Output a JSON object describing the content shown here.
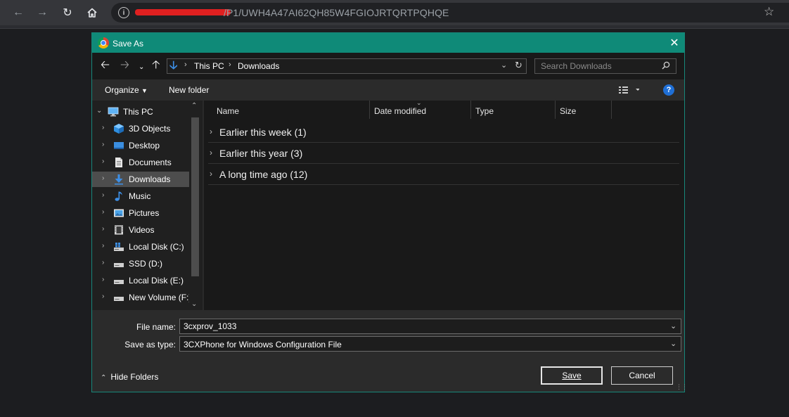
{
  "browser": {
    "url_visible": "/P1/UWH4A47AI62QH85W4FGIOJRTQRTPQHQE",
    "icons": [
      "back-icon",
      "forward-icon",
      "reload-icon",
      "home-icon",
      "info-icon",
      "star-icon"
    ]
  },
  "dialog": {
    "title": "Save As",
    "close_glyph": "✕",
    "accent_color": "#0f8a78",
    "path": {
      "crumbs": [
        "This PC",
        "Downloads"
      ]
    },
    "search": {
      "placeholder": "Search Downloads",
      "value": ""
    },
    "toolbar": {
      "organize_label": "Organize",
      "new_folder_label": "New folder",
      "help_glyph": "?"
    },
    "nav": {
      "items": [
        {
          "label": "This PC",
          "icon": "pc-icon",
          "level": 0,
          "expanded": true
        },
        {
          "label": "3D Objects",
          "icon": "3d-objects-icon",
          "level": 1
        },
        {
          "label": "Desktop",
          "icon": "desktop-icon",
          "level": 1
        },
        {
          "label": "Documents",
          "icon": "documents-icon",
          "level": 1
        },
        {
          "label": "Downloads",
          "icon": "downloads-icon",
          "level": 1,
          "selected": true
        },
        {
          "label": "Music",
          "icon": "music-icon",
          "level": 1
        },
        {
          "label": "Pictures",
          "icon": "pictures-icon",
          "level": 1
        },
        {
          "label": "Videos",
          "icon": "videos-icon",
          "level": 1
        },
        {
          "label": "Local Disk (C:)",
          "icon": "system-drive-icon",
          "level": 1
        },
        {
          "label": "SSD (D:)",
          "icon": "drive-icon",
          "level": 1
        },
        {
          "label": "Local Disk (E:)",
          "icon": "drive-icon",
          "level": 1
        },
        {
          "label": "New Volume (F:)",
          "icon": "drive-icon",
          "level": 1
        }
      ]
    },
    "columns": [
      "Name",
      "Date modified",
      "Type",
      "Size"
    ],
    "groups": [
      {
        "label": "Earlier this week (1)"
      },
      {
        "label": "Earlier this year (3)"
      },
      {
        "label": "A long time ago (12)"
      }
    ],
    "form": {
      "file_name_label": "File name:",
      "file_name_value": "3cxprov_1033",
      "save_type_label": "Save as type:",
      "save_type_value": "3CXPhone for Windows Configuration File",
      "hide_folders_label": "Hide Folders",
      "save_label": "Save",
      "cancel_label": "Cancel"
    }
  }
}
